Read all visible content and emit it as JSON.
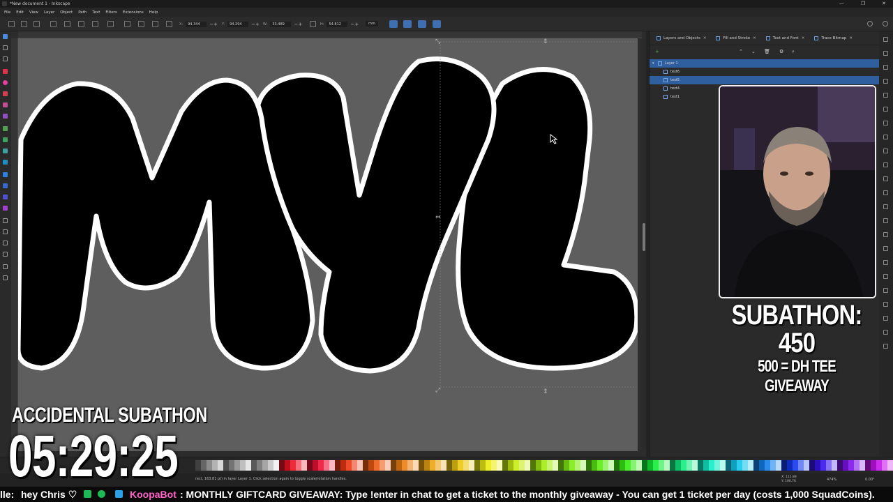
{
  "window": {
    "title": "*New document 1 - Inkscape",
    "controls": [
      "—",
      "❐",
      "✕"
    ]
  },
  "menu": [
    "File",
    "Edit",
    "View",
    "Layer",
    "Object",
    "Path",
    "Text",
    "Filters",
    "Extensions",
    "Help"
  ],
  "tool_controls": {
    "x_label": "X:",
    "x_value": "94.344",
    "y_label": "Y:",
    "y_value": "94.294",
    "w_label": "W:",
    "w_value": "33.489",
    "h_label": "H:",
    "h_value": "54.812",
    "unit": "mm"
  },
  "dock": {
    "tabs": [
      {
        "label": "Layers and Objects"
      },
      {
        "label": "Fill and Stroke"
      },
      {
        "label": "Text and Font"
      },
      {
        "label": "Trace Bitmap"
      }
    ],
    "layers": [
      {
        "label": "Layer 1",
        "selected": true,
        "indent": 0
      },
      {
        "label": "text6",
        "selected": false,
        "indent": 1
      },
      {
        "label": "text5",
        "selected": true,
        "indent": 1
      },
      {
        "label": "text4",
        "selected": false,
        "indent": 1
      },
      {
        "label": "text1",
        "selected": false,
        "indent": 1
      }
    ]
  },
  "overlay": {
    "subathon_count": "SUBATHON: 450",
    "subathon_goal": "500 = DH TEE GIVEAWAY",
    "timer_label": "ACCIDENTAL SUBATHON",
    "timer": "05:29:25"
  },
  "status": {
    "message": "rect, 163.81 pt) in layer Layer 1. Click selection again to toggle scale/rotation handles.",
    "x_coord": "X: 111.89",
    "y_coord": "Y: 106.76",
    "zoom": "474%",
    "rotation": "0.00°"
  },
  "ticker": {
    "fragment": "lle:",
    "greeting": "hey Chris ♡",
    "bot_name": "KoopaBot",
    "message": ": MONTHLY GIFTCARD GIVEAWAY: Type !enter in chat to get a ticket to the monthly giveaway - You can get 1 ticket per day (costs 1,000 SquadCoins)."
  },
  "colors": {
    "accent": "#2f5f9e",
    "canvas_page": "#5e5e5e",
    "bot_name": "#ff63c7"
  }
}
